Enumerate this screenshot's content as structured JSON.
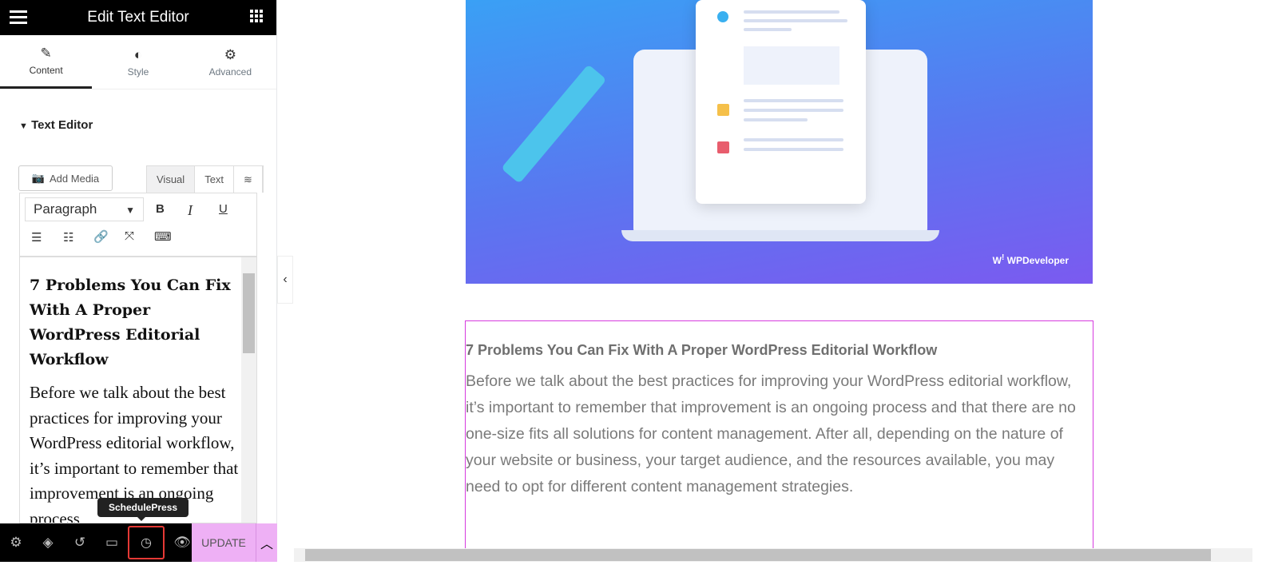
{
  "header": {
    "title": "Edit Text Editor",
    "menu_icon": "hamburger-icon",
    "apps_icon": "grid-icon"
  },
  "tabs": [
    {
      "label": "Content",
      "icon": "pencil-icon"
    },
    {
      "label": "Style",
      "icon": "half-circle-icon"
    },
    {
      "label": "Advanced",
      "icon": "gear-icon"
    }
  ],
  "section": {
    "title": "Text Editor"
  },
  "editor": {
    "add_media": "Add Media",
    "mode_visual": "Visual",
    "mode_text": "Text",
    "format": "Paragraph",
    "heading": "7 Problems You Can Fix With A Proper WordPress Editorial Workflow",
    "body": "Before we talk about the best practices for improving your WordPress editorial workflow, it’s important to remember that improvement is an ongoing process"
  },
  "footer": {
    "tooltip": "SchedulePress",
    "update": "UPDATE"
  },
  "preview": {
    "logo": "WPDeveloper",
    "heading": "7 Problems You Can Fix With A Proper WordPress Editorial Workflow",
    "body": "Before we talk about the best practices for improving your WordPress editorial workflow, it’s important to remember that improvement is an ongoing process and that there are no one-size fits all solutions for content management. After all, depending on the nature of your website or business, your target audience, and the resources available, you may need to opt for different content management strategies."
  },
  "colors": {
    "accent": "#eeb0f5",
    "selection": "#d63adf",
    "highlight": "#e53935"
  }
}
